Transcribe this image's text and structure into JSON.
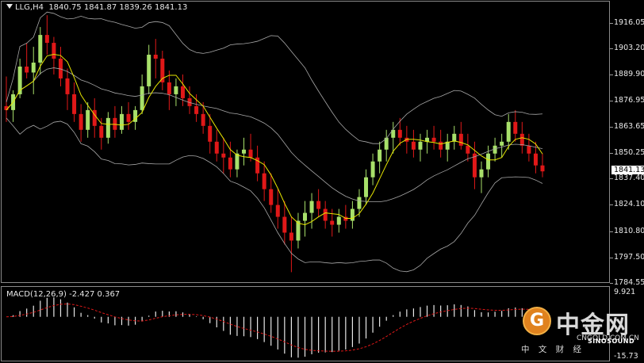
{
  "chart_header": {
    "symbol_timeframe": "LLG,H4",
    "open": "1840.75",
    "high": "1841.87",
    "low": "1839.26",
    "close": "1841.13"
  },
  "price_axis": {
    "labels": [
      "1916.05",
      "1903.20",
      "1889.90",
      "1876.95",
      "1863.65",
      "1850.25",
      "1837.40",
      "1824.10",
      "1810.80",
      "1797.50",
      "1784.55"
    ],
    "current_price": "1841.13"
  },
  "macd": {
    "label": "MACD(12,26,9) -2.427 0.367",
    "axis_labels": [
      "9.921",
      "-15.73"
    ]
  },
  "watermark": {
    "logo_glyph": "G",
    "brand_cn": "中金网",
    "url": "CNGOLD.COM.CN",
    "tagline": "中 文 财 经",
    "sino": "SINOSOUND"
  },
  "colors": {
    "background": "#000000",
    "bull_candle": "#a8e06a",
    "bear_candle": "#e01818",
    "bollinger": "#a8a8a8",
    "moving_average": "#e6e600",
    "macd_histogram": "#e8e8e8",
    "macd_signal": "#e01818"
  },
  "chart_data": {
    "type": "candlestick",
    "y_range": [
      1784.55,
      1916.05
    ],
    "candles": [
      [
        1874,
        1889,
        1866,
        1872
      ],
      [
        1872,
        1882,
        1866,
        1880
      ],
      [
        1880,
        1898,
        1878,
        1894
      ],
      [
        1894,
        1906,
        1888,
        1891
      ],
      [
        1891,
        1904,
        1880,
        1896
      ],
      [
        1896,
        1914,
        1890,
        1910
      ],
      [
        1910,
        1920,
        1900,
        1906
      ],
      [
        1906,
        1909,
        1890,
        1898
      ],
      [
        1898,
        1904,
        1884,
        1888
      ],
      [
        1888,
        1893,
        1872,
        1880
      ],
      [
        1880,
        1886,
        1866,
        1870
      ],
      [
        1870,
        1875,
        1856,
        1862
      ],
      [
        1862,
        1876,
        1858,
        1872
      ],
      [
        1872,
        1878,
        1858,
        1864
      ],
      [
        1864,
        1868,
        1852,
        1858
      ],
      [
        1858,
        1871,
        1855,
        1868
      ],
      [
        1868,
        1874,
        1858,
        1862
      ],
      [
        1862,
        1874,
        1860,
        1870
      ],
      [
        1870,
        1876,
        1862,
        1866
      ],
      [
        1866,
        1874,
        1862,
        1872
      ],
      [
        1872,
        1890,
        1870,
        1884
      ],
      [
        1884,
        1905,
        1880,
        1900
      ],
      [
        1900,
        1908,
        1888,
        1898
      ],
      [
        1898,
        1902,
        1882,
        1886
      ],
      [
        1886,
        1892,
        1872,
        1880
      ],
      [
        1880,
        1888,
        1874,
        1884
      ],
      [
        1884,
        1890,
        1874,
        1878
      ],
      [
        1878,
        1884,
        1870,
        1874
      ],
      [
        1874,
        1880,
        1866,
        1870
      ],
      [
        1870,
        1876,
        1860,
        1864
      ],
      [
        1864,
        1870,
        1850,
        1856
      ],
      [
        1856,
        1862,
        1846,
        1850
      ],
      [
        1850,
        1858,
        1840,
        1848
      ],
      [
        1848,
        1856,
        1838,
        1842
      ],
      [
        1842,
        1852,
        1838,
        1850
      ],
      [
        1850,
        1858,
        1844,
        1852
      ],
      [
        1852,
        1860,
        1846,
        1848
      ],
      [
        1848,
        1854,
        1836,
        1840
      ],
      [
        1840,
        1846,
        1826,
        1832
      ],
      [
        1832,
        1840,
        1820,
        1824
      ],
      [
        1824,
        1832,
        1812,
        1818
      ],
      [
        1818,
        1826,
        1804,
        1810
      ],
      [
        1810,
        1818,
        1790,
        1806
      ],
      [
        1806,
        1820,
        1802,
        1816
      ],
      [
        1816,
        1826,
        1808,
        1820
      ],
      [
        1820,
        1830,
        1812,
        1826
      ],
      [
        1826,
        1832,
        1818,
        1822
      ],
      [
        1822,
        1826,
        1812,
        1816
      ],
      [
        1816,
        1822,
        1808,
        1814
      ],
      [
        1814,
        1822,
        1810,
        1818
      ],
      [
        1818,
        1824,
        1812,
        1816
      ],
      [
        1816,
        1826,
        1812,
        1822
      ],
      [
        1822,
        1832,
        1818,
        1828
      ],
      [
        1828,
        1842,
        1824,
        1838
      ],
      [
        1838,
        1850,
        1834,
        1846
      ],
      [
        1846,
        1856,
        1840,
        1852
      ],
      [
        1852,
        1862,
        1846,
        1858
      ],
      [
        1858,
        1866,
        1850,
        1862
      ],
      [
        1862,
        1868,
        1854,
        1858
      ],
      [
        1858,
        1864,
        1850,
        1856
      ],
      [
        1856,
        1862,
        1848,
        1852
      ],
      [
        1852,
        1860,
        1846,
        1856
      ],
      [
        1856,
        1862,
        1850,
        1858
      ],
      [
        1858,
        1864,
        1852,
        1856
      ],
      [
        1856,
        1862,
        1848,
        1852
      ],
      [
        1852,
        1860,
        1846,
        1856
      ],
      [
        1856,
        1864,
        1852,
        1860
      ],
      [
        1860,
        1866,
        1852,
        1854
      ],
      [
        1854,
        1860,
        1846,
        1850
      ],
      [
        1850,
        1856,
        1832,
        1838
      ],
      [
        1838,
        1846,
        1830,
        1842
      ],
      [
        1842,
        1854,
        1838,
        1850
      ],
      [
        1850,
        1858,
        1846,
        1854
      ],
      [
        1854,
        1860,
        1848,
        1856
      ],
      [
        1856,
        1870,
        1852,
        1866
      ],
      [
        1866,
        1872,
        1856,
        1860
      ],
      [
        1860,
        1866,
        1850,
        1854
      ],
      [
        1854,
        1860,
        1846,
        1850
      ],
      [
        1850,
        1856,
        1840,
        1844
      ],
      [
        1844,
        1850,
        1838,
        1841
      ]
    ],
    "x_labels": []
  }
}
